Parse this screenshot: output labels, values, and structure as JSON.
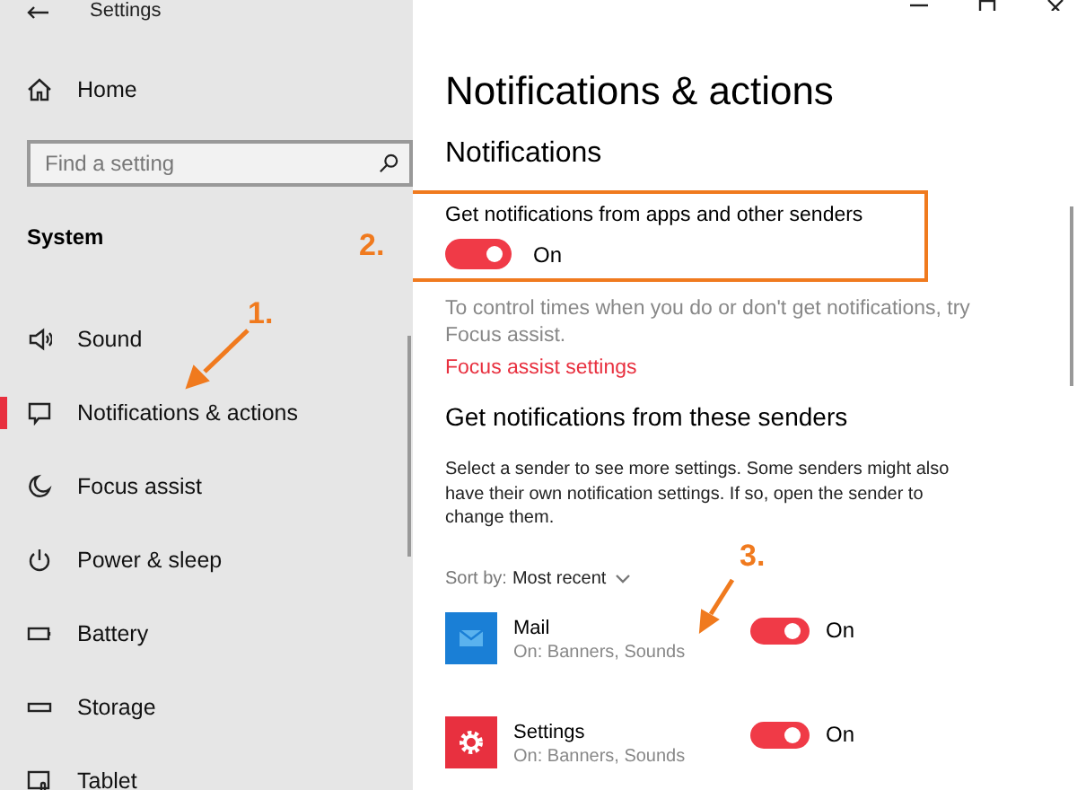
{
  "window": {
    "title": "Settings"
  },
  "sidebar": {
    "home": "Home",
    "search": {
      "placeholder": "Find a setting"
    },
    "section": "System",
    "items": [
      {
        "label": "Sound",
        "selected": false
      },
      {
        "label": "Notifications & actions",
        "selected": true
      },
      {
        "label": "Focus assist",
        "selected": false
      },
      {
        "label": "Power & sleep",
        "selected": false
      },
      {
        "label": "Battery",
        "selected": false
      },
      {
        "label": "Storage",
        "selected": false
      },
      {
        "label": "Tablet",
        "selected": false
      }
    ]
  },
  "main": {
    "title": "Notifications & actions",
    "section": "Notifications",
    "master": {
      "label": "Get notifications from apps and other senders",
      "on": true,
      "state": "On"
    },
    "hint": "To control times when you do or don't get notifications, try Focus assist.",
    "link": "Focus assist settings",
    "senders_heading": "Get notifications from these senders",
    "senders_note": "Select a sender to see more settings. Some senders might also have their own notification settings. If so, open the sender to change them.",
    "sort": {
      "label": "Sort by:",
      "value": "Most recent"
    },
    "senders": [
      {
        "name": "Mail",
        "status": "On: Banners, Sounds",
        "on": true,
        "state": "On"
      },
      {
        "name": "Settings",
        "status": "On: Banners, Sounds",
        "on": true,
        "state": "On"
      }
    ]
  },
  "annotations": [
    {
      "label": "1."
    },
    {
      "label": "2."
    },
    {
      "label": "3."
    }
  ]
}
